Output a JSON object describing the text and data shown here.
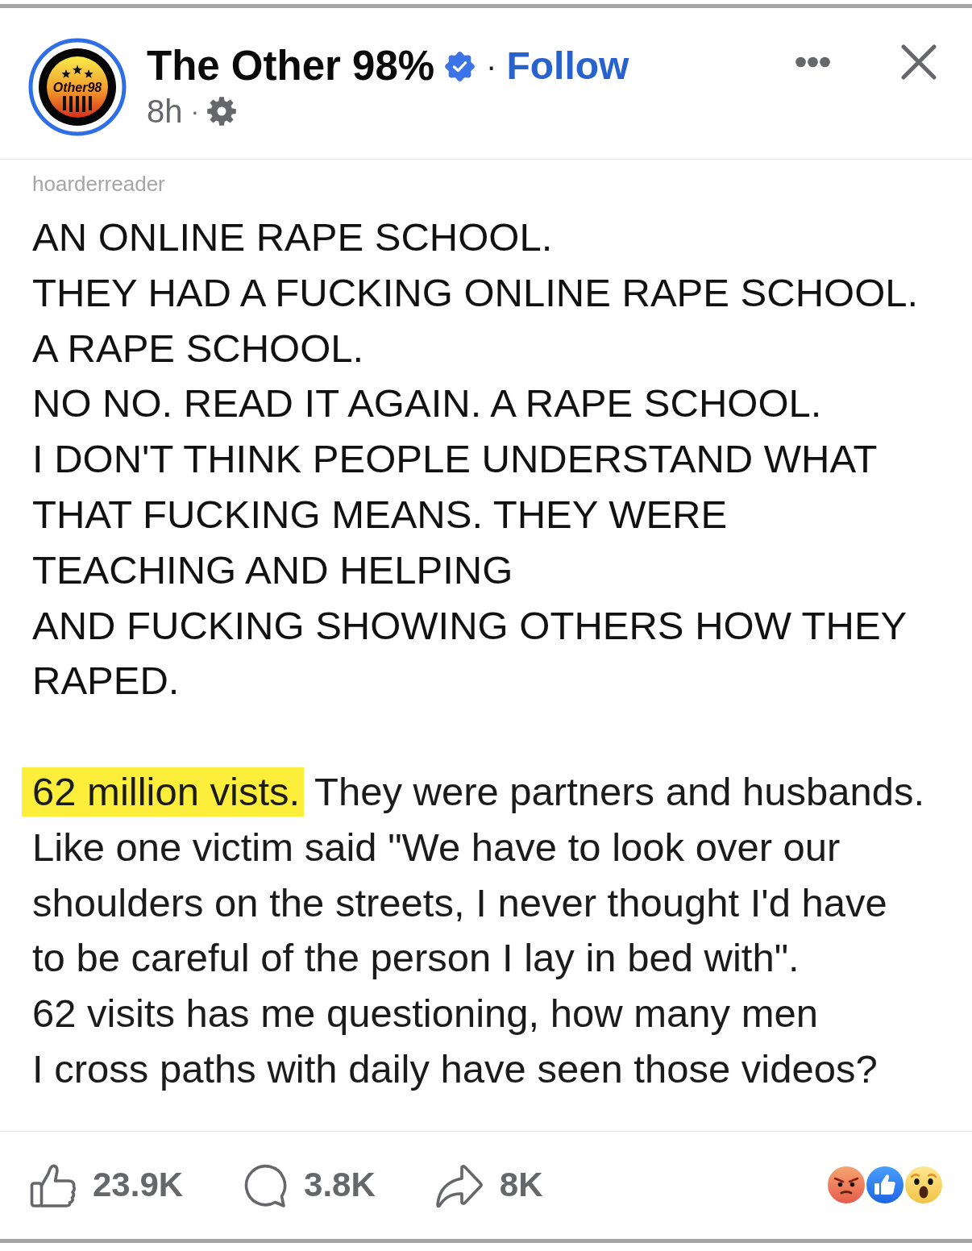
{
  "post_header": {
    "page_name": "The Other 98%",
    "verified": true,
    "separator": "·",
    "follow_label": "Follow",
    "time": "8h",
    "time_separator": "·"
  },
  "avatar": {
    "logo_text": "Other98"
  },
  "shared_post": {
    "author": "hoarderreader",
    "paragraphs": [
      {
        "lines": [
          {
            "segments": [
              {
                "text": "AN ONLINE RAPE SCHOOL.",
                "highlighted": false
              }
            ]
          },
          {
            "segments": [
              {
                "text": "THEY HAD A FUCKING ONLINE RAPE SCHOOL.",
                "highlighted": false
              }
            ]
          },
          {
            "segments": [
              {
                "text": "A RAPE SCHOOL.",
                "highlighted": false
              }
            ]
          },
          {
            "segments": [
              {
                "text": "NO NO. READ IT AGAIN. A RAPE SCHOOL.",
                "highlighted": false
              }
            ]
          },
          {
            "segments": [
              {
                "text": "I DON'T THINK PEOPLE UNDERSTAND WHAT",
                "highlighted": false
              }
            ]
          },
          {
            "segments": [
              {
                "text": "THAT FUCKING MEANS. THEY WERE",
                "highlighted": false
              }
            ]
          },
          {
            "segments": [
              {
                "text": "TEACHING AND HELPING",
                "highlighted": false
              }
            ]
          },
          {
            "segments": [
              {
                "text": "AND FUCKING SHOWING OTHERS HOW THEY",
                "highlighted": false
              }
            ]
          },
          {
            "segments": [
              {
                "text": "RAPED.",
                "highlighted": false
              }
            ]
          }
        ]
      },
      {
        "lines": [
          {
            "segments": [
              {
                "text": "62 million vists.",
                "highlighted": true
              },
              {
                "text": "They were partners and husbands.",
                "highlighted": false
              }
            ]
          },
          {
            "segments": [
              {
                "text": "Like one victim said \"We have to look over our",
                "highlighted": false
              }
            ]
          },
          {
            "segments": [
              {
                "text": "shoulders on the streets, I never thought I'd have",
                "highlighted": false
              }
            ]
          },
          {
            "segments": [
              {
                "text": "to be careful of the person I lay in bed with\".",
                "highlighted": false
              }
            ]
          },
          {
            "segments": [
              {
                "text": "62 visits has me questioning, how many men",
                "highlighted": false
              }
            ]
          },
          {
            "segments": [
              {
                "text": "I cross paths with daily have seen those videos?",
                "highlighted": false
              }
            ]
          }
        ]
      }
    ]
  },
  "actions": [
    {
      "kind": "like",
      "count": "23.9K"
    },
    {
      "kind": "comment",
      "count": "3.8K"
    },
    {
      "kind": "share",
      "count": "8K"
    }
  ]
}
